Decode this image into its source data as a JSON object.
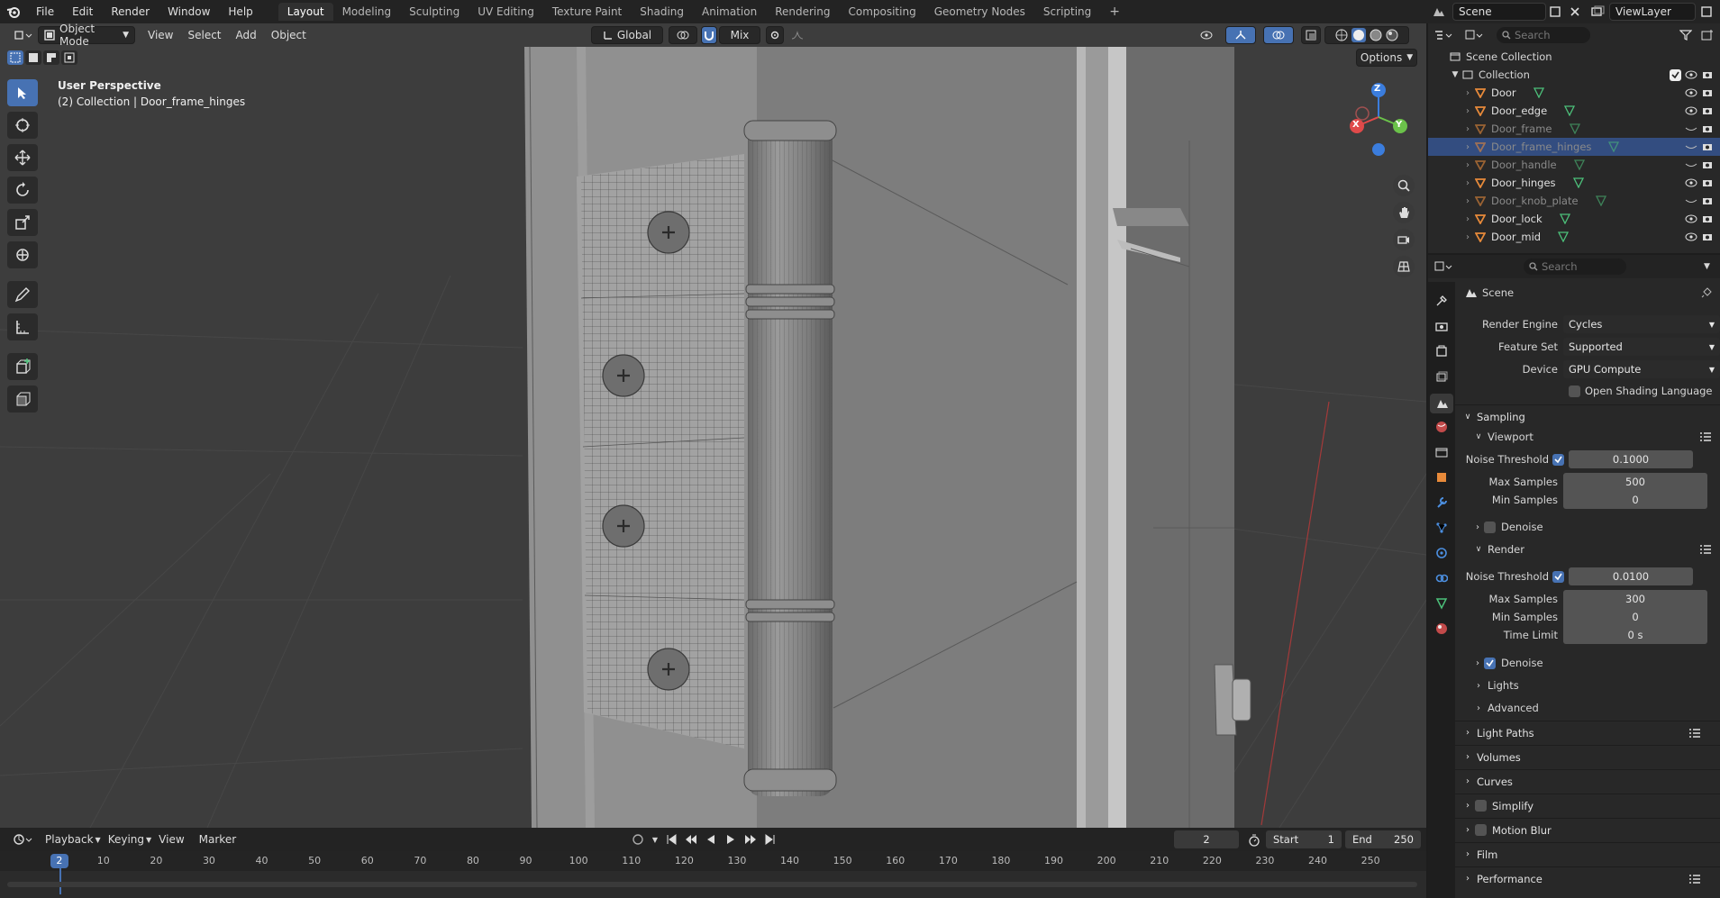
{
  "topbar": {
    "menus": [
      "File",
      "Edit",
      "Render",
      "Window",
      "Help"
    ],
    "workspaces": [
      "Layout",
      "Modeling",
      "Sculpting",
      "UV Editing",
      "Texture Paint",
      "Shading",
      "Animation",
      "Rendering",
      "Compositing",
      "Geometry Nodes",
      "Scripting"
    ],
    "active_workspace": "Layout",
    "scene": "Scene",
    "view_layer": "ViewLayer"
  },
  "viewport": {
    "mode": "Object Mode",
    "menus": [
      "View",
      "Select",
      "Add",
      "Object"
    ],
    "orientation": "Global",
    "snap_mix": "Mix",
    "options": "Options",
    "perspective": "User Perspective",
    "collection_info": "(2) Collection | Door_frame_hinges",
    "gizmo": {
      "z": "Z",
      "x": "X",
      "y": "Y"
    }
  },
  "timeline": {
    "menus": [
      "Playback",
      "Keying",
      "View",
      "Marker"
    ],
    "current_frame": "2",
    "start_label": "Start",
    "start": "1",
    "end_label": "End",
    "end": "250",
    "ticks": [
      "10",
      "20",
      "30",
      "40",
      "50",
      "60",
      "70",
      "80",
      "90",
      "100",
      "110",
      "120",
      "130",
      "140",
      "150",
      "160",
      "170",
      "180",
      "190",
      "200",
      "210",
      "220",
      "230",
      "240",
      "250"
    ],
    "playhead": "2"
  },
  "outliner": {
    "search_placeholder": "Search",
    "scene_collection": "Scene Collection",
    "collection": "Collection",
    "items": [
      {
        "name": "Door",
        "state": "visible"
      },
      {
        "name": "Door_edge",
        "state": "visible"
      },
      {
        "name": "Door_frame",
        "state": "hidden"
      },
      {
        "name": "Door_frame_hinges",
        "state": "selected"
      },
      {
        "name": "Door_handle",
        "state": "hidden"
      },
      {
        "name": "Door_hinges",
        "state": "visible"
      },
      {
        "name": "Door_knob_plate",
        "state": "hidden"
      },
      {
        "name": "Door_lock",
        "state": "visible"
      },
      {
        "name": "Door_mid",
        "state": "visible"
      }
    ]
  },
  "properties": {
    "search_placeholder": "Search",
    "context": "Scene",
    "render_engine_label": "Render Engine",
    "render_engine": "Cycles",
    "feature_set_label": "Feature Set",
    "feature_set": "Supported",
    "device_label": "Device",
    "device": "GPU Compute",
    "osl_label": "Open Shading Language",
    "sampling": "Sampling",
    "viewport_label": "Viewport",
    "vp_noise_label": "Noise Threshold",
    "vp_noise": "0.1000",
    "vp_max_label": "Max Samples",
    "vp_max": "500",
    "vp_min_label": "Min Samples",
    "vp_min": "0",
    "vp_denoise": "Denoise",
    "render_label": "Render",
    "r_noise_label": "Noise Threshold",
    "r_noise": "0.0100",
    "r_max_label": "Max Samples",
    "r_max": "300",
    "r_min_label": "Min Samples",
    "r_min": "0",
    "r_time_label": "Time Limit",
    "r_time": "0 s",
    "r_denoise": "Denoise",
    "lights": "Lights",
    "advanced": "Advanced",
    "sections": [
      "Light Paths",
      "Volumes",
      "Curves",
      "Simplify",
      "Motion Blur",
      "Film",
      "Performance"
    ]
  },
  "colors": {
    "accent": "#4772b3",
    "selected_row": "#334d80",
    "object_orange": "#e88a3a",
    "mesh_green": "#4cc07a"
  }
}
